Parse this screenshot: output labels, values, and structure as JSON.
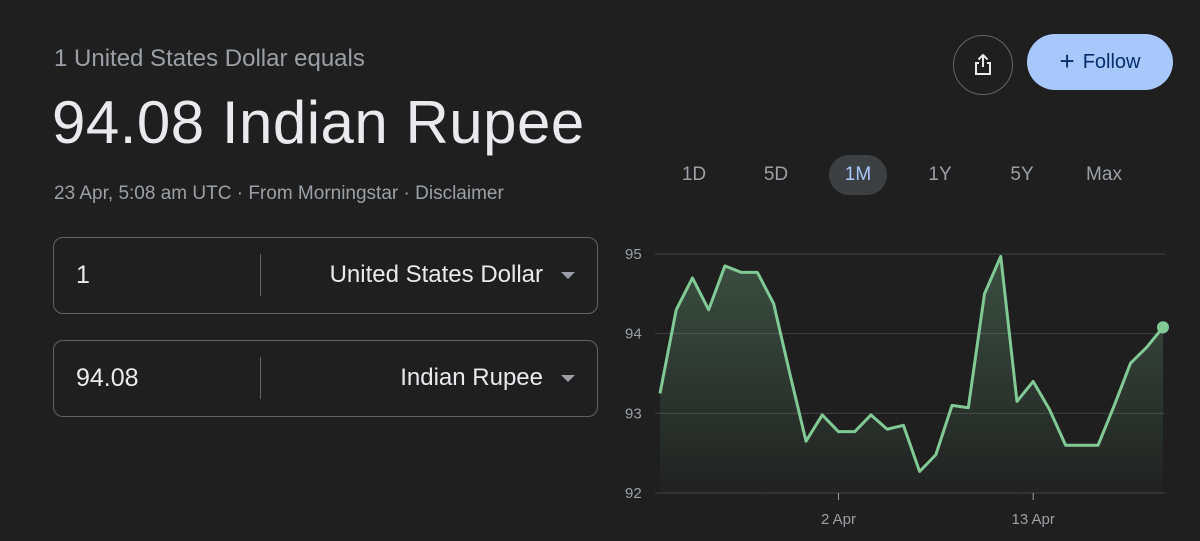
{
  "header": {
    "subtitle": "1 United States Dollar equals",
    "value_line": "94.08 Indian Rupee",
    "timestamp": "23 Apr, 5:08 am UTC",
    "sep1": " · ",
    "source": "From Morningstar",
    "sep2": " · ",
    "disclaimer": "Disclaimer"
  },
  "converter": {
    "from": {
      "amount": "1",
      "currency": "United States Dollar"
    },
    "to": {
      "amount": "94.08",
      "currency": "Indian Rupee"
    }
  },
  "actions": {
    "share_icon": "share-icon",
    "follow_label": "Follow",
    "follow_icon": "plus-icon",
    "follow_color": "#a8c7fa"
  },
  "range_tabs": [
    "1D",
    "5D",
    "1M",
    "1Y",
    "5Y",
    "Max"
  ],
  "active_range": "1M",
  "chart_data": {
    "type": "area",
    "line_color": "#81c995",
    "ylim": [
      92,
      95
    ],
    "y_ticks": [
      "95",
      "94",
      "93",
      "92"
    ],
    "x_ticks": [
      "2 Apr",
      "13 Apr"
    ],
    "x_tick_index": [
      11,
      23
    ],
    "values": [
      93.25,
      94.3,
      94.7,
      94.3,
      94.85,
      94.77,
      94.77,
      94.38,
      93.5,
      92.65,
      92.98,
      92.77,
      92.77,
      92.98,
      92.8,
      92.85,
      92.27,
      92.48,
      93.1,
      93.07,
      94.5,
      94.97,
      93.15,
      93.4,
      93.05,
      92.6,
      92.6,
      92.6,
      93.1,
      93.63,
      93.83,
      94.08
    ]
  }
}
